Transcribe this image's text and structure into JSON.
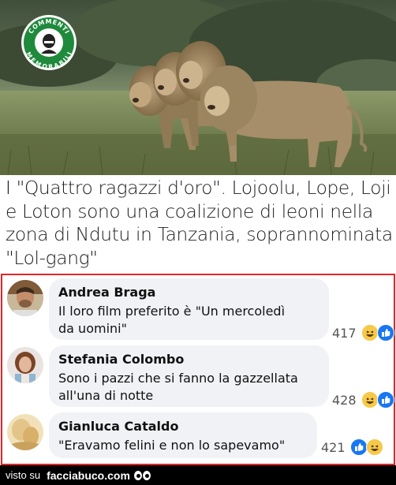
{
  "logo": {
    "line1": "COMMENTI",
    "line2": "MEMORABILI"
  },
  "caption": {
    "lines": [
      "I \"Quattro ragazzi d'oro\". Lojoolu, Lope, Loji",
      "e Loton sono una coalizione di leoni nella",
      "zona di Ndutu in Tanzania, soprannominata",
      "\"Lol-gang\""
    ]
  },
  "comments": [
    {
      "author": "Andrea Braga",
      "lines": [
        "Il loro film preferito è \"Un mercoledì",
        "da uomini\""
      ],
      "reaction_count": "417",
      "reactions": [
        "haha",
        "like"
      ]
    },
    {
      "author": "Stefania Colombo",
      "lines": [
        "Sono i pazzi che si fanno la gazzellata",
        "all'una di notte"
      ],
      "reaction_count": "428",
      "reactions": [
        "haha",
        "like"
      ]
    },
    {
      "author": "Gianluca Cataldo",
      "lines": [
        "\"Eravamo felini e non lo sapevamo\""
      ],
      "reaction_count": "421",
      "reactions": [
        "like",
        "haha"
      ]
    }
  ],
  "footer": {
    "visto": "visto su",
    "site": "facciabuco.com"
  },
  "colors": {
    "frame": "#e0262a",
    "bubble": "#f0f2f5",
    "like": "#1877f2",
    "haha": "#f7c94a"
  }
}
